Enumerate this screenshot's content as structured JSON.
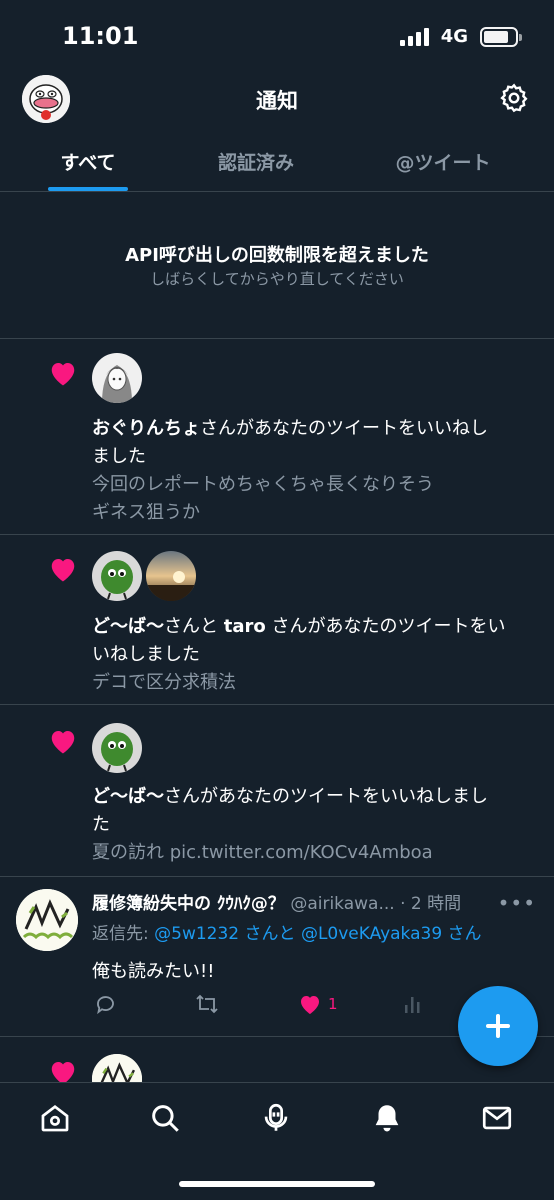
{
  "status_bar": {
    "time": "11:01",
    "network": "4G"
  },
  "header": {
    "title": "通知"
  },
  "tabs": [
    {
      "label": "すべて",
      "active": true
    },
    {
      "label": "認証済み",
      "active": false
    },
    {
      "label": "@ツイート",
      "active": false
    }
  ],
  "error": {
    "title": "API呼び出しの回数制限を超えました",
    "subtitle": "しばらくしてからやり直してください"
  },
  "notifications": [
    {
      "users": [
        "おぐりんちょ"
      ],
      "action_text": "さんがあなたのツイートをいいねしました",
      "line1_rest": "さんがあなたのツイートをいいねし",
      "line2": "ました",
      "preview1": "今回のレポートめちゃくちゃ長くなりそう",
      "preview2": "ギネス狙うか"
    },
    {
      "users": [
        "ど〜ば〜",
        "taro"
      ],
      "connector": "さんと ",
      "line1_rest": " さんがあなたのツイートをい",
      "line2": "いねしました",
      "preview1": "デコで区分求積法"
    },
    {
      "users": [
        "ど〜ば〜"
      ],
      "line1_rest": "さんがあなたのツイートをいいねしまし",
      "line2": "た",
      "preview1": "夏の訪れ pic.twitter.com/KOCv4Amboa"
    }
  ],
  "tweet": {
    "name": "履修簿紛失中の ｸｳﾊｸ@？",
    "handle": "@airikawa...",
    "time": "· 2 時間",
    "reply_prefix": "返信先: ",
    "reply_user1": "@5w1232",
    "reply_mid": " さんと ",
    "reply_user2": "@L0veKAyaka39",
    "reply_suffix": " さん",
    "body": "俺も読みたい!!",
    "like_count": "1"
  },
  "colors": {
    "background": "#15202b",
    "accent": "#1d9bf0",
    "like": "#f91880",
    "secondary_text": "#8b98a5",
    "divider": "#38444d"
  },
  "icons": [
    "settings-gear-icon",
    "heart-icon",
    "reply-icon",
    "retweet-icon",
    "analytics-icon",
    "more-icon",
    "home-icon",
    "search-icon",
    "spaces-icon",
    "notifications-bell-icon",
    "messages-icon",
    "compose-plus-icon"
  ]
}
